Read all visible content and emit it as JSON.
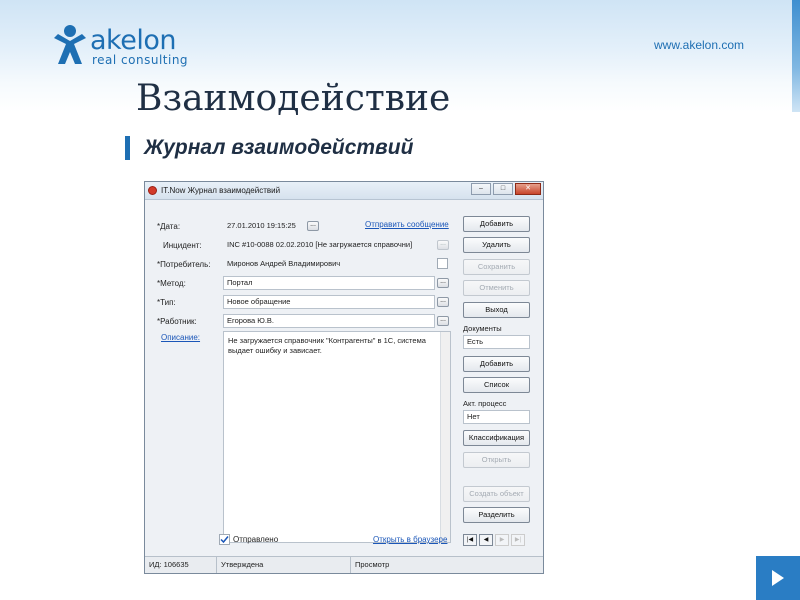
{
  "header": {
    "logo_text": "akelon",
    "logo_sub": "real consulting",
    "site_url": "www.akelon.com",
    "brand_color": "#1e6fb3"
  },
  "slide": {
    "title": "Взаимодействие",
    "subtitle": "Журнал взаимодействий",
    "next_icon": "play-triangle-icon"
  },
  "window": {
    "title": "IT.Now Журнал взаимодействий",
    "icon": "app-logo-icon",
    "controls": {
      "minimize": "–",
      "maximize": "□",
      "close": "✕"
    },
    "form": {
      "date": {
        "label": "*Дата:",
        "value": "27.01.2010 19:15:25"
      },
      "send_message_link": "Отправить сообщение",
      "incident": {
        "label": "Инцидент:",
        "value": "INC #10-0088 02.02.2010 [Не загружается справочни]"
      },
      "consumer": {
        "label": "*Потребитель:",
        "value": "Миронов Андрей Владимирович"
      },
      "method": {
        "label": "*Метод:",
        "value": "Портал"
      },
      "type": {
        "label": "*Тип:",
        "value": "Новое обращение"
      },
      "worker": {
        "label": "*Работник:",
        "value": "Егорова Ю.В."
      },
      "description_link": "Описание:",
      "description_text": "Не загружается справочник \"Контрагенты\" в 1С, система выдает ошибку и зависает.",
      "sent_checkbox": {
        "label": "Отправлено",
        "checked": true
      },
      "open_browser_link": "Открыть в браузере",
      "picker_glyph": "..."
    },
    "side": {
      "add": "Добавить",
      "delete": "Удалить",
      "save": "Сохранить",
      "cancel": "Отменить",
      "exit": "Выход",
      "documents_label": "Документы",
      "documents_value": "Есть",
      "docs_add": "Добавить",
      "docs_list": "Список",
      "process_label": "Акт. процесс",
      "process_value": "Нет",
      "classification": "Классификация",
      "open": "Открыть",
      "create_object": "Создать объект",
      "split": "Разделить"
    },
    "nav": {
      "first": "|◀",
      "prev": "◀",
      "next": "▶",
      "last": "▶|"
    },
    "status": {
      "id": "ИД: 106635",
      "state": "Утверждена",
      "mode": "Просмотр"
    }
  }
}
